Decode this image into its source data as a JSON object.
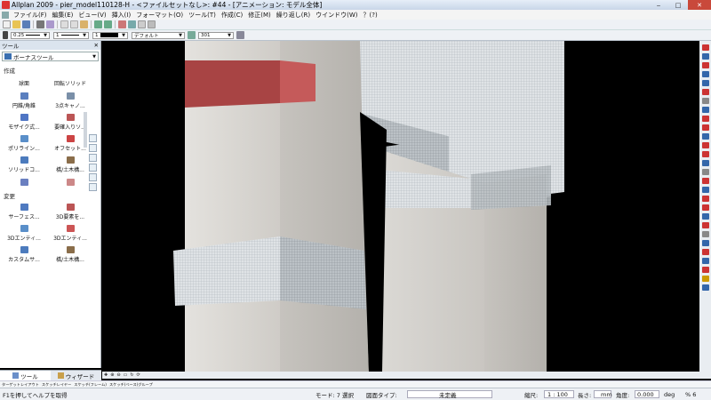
{
  "window": {
    "title": "Allplan 2009 - pier_model110128-H - <ファイルセットなし>: #44 - [アニメーション: モデル全体]",
    "min": "‒",
    "max": "□",
    "close": "✕"
  },
  "menu": [
    "ファイル(F)",
    "編集(E)",
    "ビュー(V)",
    "挿入(I)",
    "フォーマット(O)",
    "ツール(T)",
    "作成(C)",
    "修正(M)",
    "繰り返し(R)",
    "ウインドウ(W)",
    "？(?)"
  ],
  "format_bar": {
    "pen": "0.25",
    "line": "1",
    "color": "1",
    "layer_label": "デフォルト",
    "number": "301"
  },
  "palette": {
    "header": "ツール",
    "close": "✕",
    "dropdown": "ボーナスツール",
    "section_create": "作成",
    "create_items": [
      "球面",
      "回転ソリッド",
      "円錐/角錐",
      "3点キャノ...",
      "モザイク式...",
      "要確入りソ...",
      "ポリライン...",
      "オフセット...",
      "ソリッドコ...",
      "橋/土木構..."
    ],
    "section_modify": "変更",
    "modify_items": [
      "サーフェス...",
      "3D要素を...",
      "3Dエンティ...",
      "3Dエンティ...",
      "カスタムサ...",
      "橋/土木構..."
    ],
    "tab_tools": "ツール",
    "tab_wizard": "ウィザード"
  },
  "layer_tabs": [
    "ターゲットレイアウト",
    "スケッチレイヤー",
    "スケッチ(フレーム)",
    "スケッチ(ベース)グループ"
  ],
  "status": {
    "help": "F1を押してヘルプを取得",
    "mode": "モード: 7 選択",
    "sheet": "図面タイプ:",
    "undefined": "未定義",
    "scale_label": "縮尺:",
    "scale": "1 : 100",
    "length_label": "長さ:",
    "length_unit": "mm",
    "angle_label": "角度:",
    "angle": "0.000",
    "angle_unit": "deg",
    "percent": "% 6"
  },
  "colors": {
    "red_band": "#a84444",
    "concrete": "#d6d4d0",
    "viewport_bg": "#000000"
  }
}
